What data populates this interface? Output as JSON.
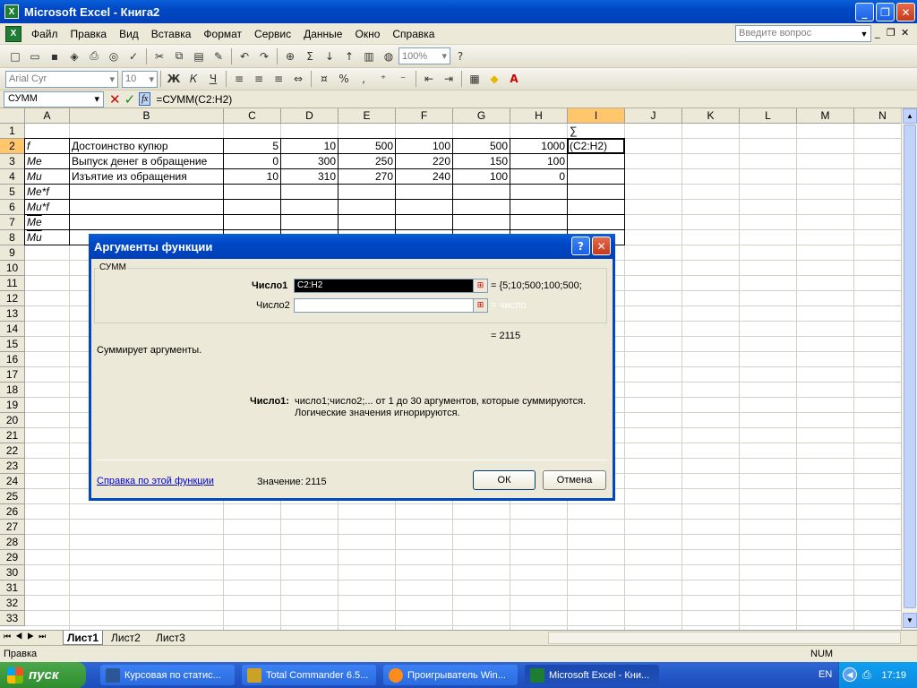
{
  "app": {
    "title": "Microsoft Excel - Книга2"
  },
  "menu": {
    "items": [
      "Файл",
      "Правка",
      "Вид",
      "Вставка",
      "Формат",
      "Сервис",
      "Данные",
      "Окно",
      "Справка"
    ],
    "ask_placeholder": "Введите вопрос"
  },
  "toolbar": {
    "zoom": "100%",
    "font": "Arial Cyr",
    "size": "10",
    "bold": "Ж",
    "italic": "К",
    "underline": "Ч"
  },
  "formula_bar": {
    "name_box": "СУММ",
    "formula": "=СУММ(C2:H2)",
    "fx": "fx"
  },
  "grid": {
    "columns": [
      "A",
      "B",
      "C",
      "D",
      "E",
      "F",
      "G",
      "H",
      "I",
      "J",
      "K",
      "L",
      "M",
      "N"
    ],
    "rows": [
      "1",
      "2",
      "3",
      "4",
      "5",
      "6",
      "7",
      "8",
      "9",
      "10",
      "11",
      "12",
      "13",
      "14",
      "15",
      "16",
      "17",
      "18",
      "19",
      "20",
      "21",
      "22",
      "23",
      "24",
      "25",
      "26",
      "27",
      "28",
      "29",
      "30",
      "31",
      "32",
      "33"
    ],
    "cells": {
      "A2": "f",
      "B2": "Достоинство купюр",
      "C2": "5",
      "D2": "10",
      "E2": "500",
      "F2": "100",
      "G2": "500",
      "H2": "1000",
      "A3": "Me",
      "B3": "Выпуск денег в обращение",
      "C3": "0",
      "D3": "300",
      "E3": "250",
      "F3": "220",
      "G3": "150",
      "H3": "100",
      "A4": "Mu",
      "B4": "Изъятие из обращения",
      "C4": "10",
      "D4": "310",
      "E4": "270",
      "F4": "240",
      "G4": "100",
      "H4": "0",
      "A5": "Me*f",
      "A6": "Mu*f",
      "A7": "Me",
      "A8": "Mu",
      "I1": "∑",
      "I2": "(C2:H2)"
    }
  },
  "sheets": [
    "Лист1",
    "Лист2",
    "Лист3"
  ],
  "status": {
    "left": "Правка",
    "num": "NUM"
  },
  "dialog": {
    "title": "Аргументы функции",
    "group": "СУММ",
    "arg1_label": "Число1",
    "arg1_value": "C2:H2",
    "arg1_result": "= {5;10;500;100;500;",
    "arg2_label": "Число2",
    "arg2_result": "= число",
    "total": "= 2115",
    "description": "Суммирует аргументы.",
    "arg_help_label": "Число1:",
    "arg_help_line1": "число1;число2;... от 1 до 30 аргументов, которые суммируются.",
    "arg_help_line2": "Логические значения игнорируются.",
    "help_link": "Справка по этой функции",
    "value_label": "Значение:",
    "value": "2115",
    "ok": "ОК",
    "cancel": "Отмена"
  },
  "taskbar": {
    "start": "пуск",
    "tasks": [
      "Курсовая по статис...",
      "Total Commander 6.5...",
      "Проигрыватель Win...",
      "Microsoft Excel - Кни..."
    ],
    "lang": "EN",
    "clock": "17:19"
  },
  "colors": {
    "titlebar": "#0047c4",
    "taskbar": "#245edb",
    "start": "#3c9a3c",
    "selection_header": "#ffc66b"
  }
}
